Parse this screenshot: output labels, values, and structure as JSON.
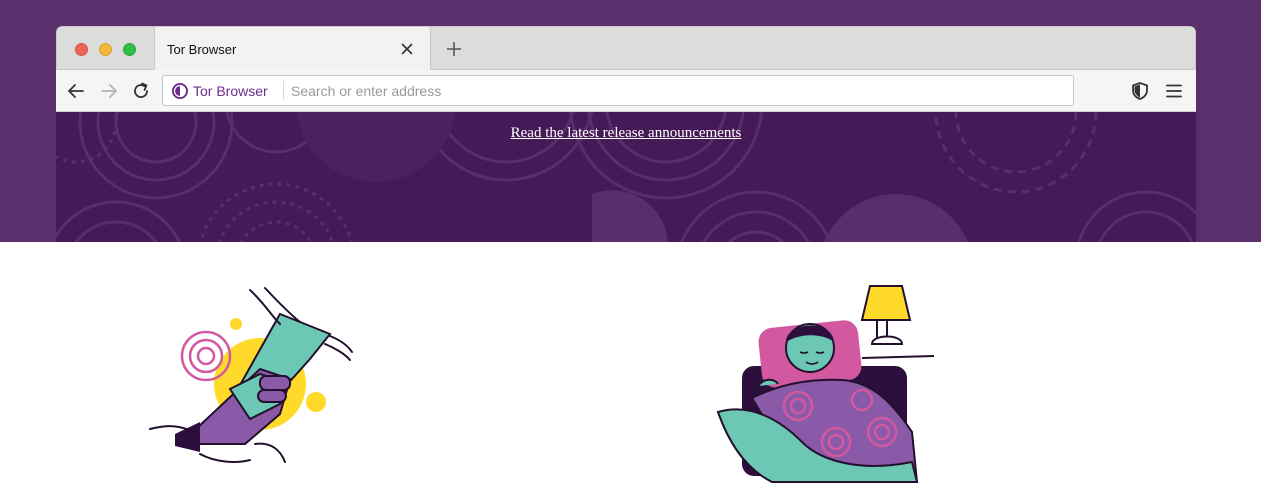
{
  "window": {
    "tab": {
      "title": "Tor Browser"
    },
    "toolbar": {
      "identity_label": "Tor Browser",
      "url_placeholder": "Search or enter address",
      "url_value": ""
    }
  },
  "banner": {
    "link_text": "Read the latest release announcements"
  },
  "colors": {
    "frame_purple": "#5b2f6b",
    "banner_purple": "#451a56",
    "accent_purple": "#6b2d8c",
    "teal": "#6cc8b5",
    "yellow": "#ffda2a",
    "pink": "#d2589f"
  },
  "icons": {
    "back": "arrow-left-icon",
    "forward": "arrow-right-icon",
    "reload": "reload-icon",
    "identity": "onion-icon",
    "security": "shield-icon",
    "menu": "hamburger-menu-icon",
    "close_tab": "close-icon",
    "new_tab": "plus-icon"
  }
}
